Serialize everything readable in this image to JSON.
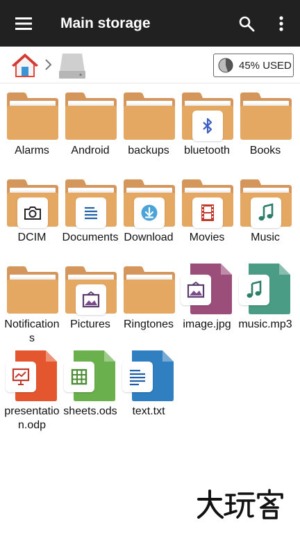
{
  "appbar": {
    "title": "Main storage",
    "menu_icon": "hamburger-menu-icon",
    "search_icon": "search-icon",
    "more_icon": "more-vert-icon"
  },
  "breadcrumb": {
    "home_icon": "home-icon",
    "separator_icon": "chevron-right-icon",
    "drive_icon": "storage-drive-icon"
  },
  "usage": {
    "label": "45% USED",
    "fraction": 0.45
  },
  "colors": {
    "appbar": "#212121",
    "folder": "#e5a863",
    "folder_back": "#d4965a",
    "image_file": "#9c4e7a",
    "audio_file": "#4a9c85",
    "presentation_file": "#e4572e",
    "sheets_file": "#6ab04c",
    "text_file": "#2f7fc1"
  },
  "items": [
    {
      "name": "Alarms",
      "kind": "folder",
      "badge": ""
    },
    {
      "name": "Android",
      "kind": "folder",
      "badge": ""
    },
    {
      "name": "backups",
      "kind": "folder",
      "badge": ""
    },
    {
      "name": "bluetooth",
      "kind": "folder",
      "badge": "bluetooth-icon"
    },
    {
      "name": "Books",
      "kind": "folder",
      "badge": ""
    },
    {
      "name": "DCIM",
      "kind": "folder",
      "badge": "camera-icon"
    },
    {
      "name": "Documents",
      "kind": "folder",
      "badge": "document-icon"
    },
    {
      "name": "Download",
      "kind": "folder",
      "badge": "download-icon"
    },
    {
      "name": "Movies",
      "kind": "folder",
      "badge": "film-icon"
    },
    {
      "name": "Music",
      "kind": "folder",
      "badge": "music-note-icon"
    },
    {
      "name": "Notifications",
      "kind": "folder",
      "badge": ""
    },
    {
      "name": "Pictures",
      "kind": "folder",
      "badge": "picture-icon"
    },
    {
      "name": "Ringtones",
      "kind": "folder",
      "badge": ""
    },
    {
      "name": "image.jpg",
      "kind": "file",
      "badge": "picture-icon",
      "color": "#9c4e7a"
    },
    {
      "name": "music.mp3",
      "kind": "file",
      "badge": "music-note-icon",
      "color": "#4a9c85"
    },
    {
      "name": "presentation.odp",
      "kind": "file",
      "badge": "presentation-icon",
      "color": "#e4572e"
    },
    {
      "name": "sheets.ods",
      "kind": "file",
      "badge": "spreadsheet-icon",
      "color": "#6ab04c"
    },
    {
      "name": "text.txt",
      "kind": "file",
      "badge": "text-lines-icon",
      "color": "#2f7fc1"
    }
  ],
  "watermark": {
    "text": "大玩客"
  }
}
